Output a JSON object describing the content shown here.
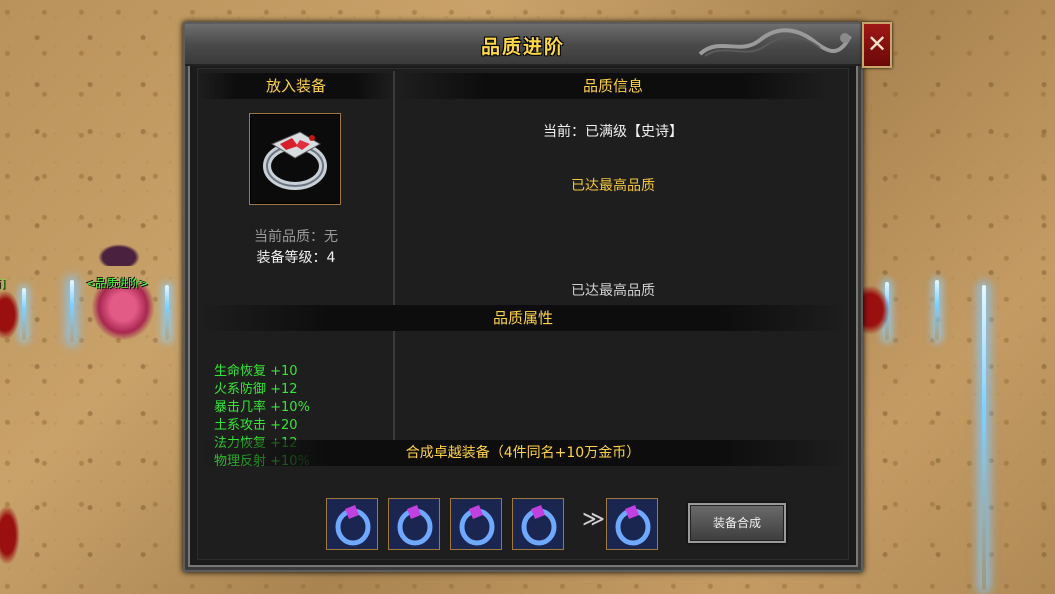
{
  "world": {
    "npc_name": "<品质进阶>",
    "npc_name_left": "商]"
  },
  "dialog": {
    "title": "品质进阶",
    "close_label": "✕"
  },
  "left_panel": {
    "header": "放入装备",
    "current_quality": "当前品质：无",
    "equip_level": "装备等级：4"
  },
  "right_panel": {
    "header": "品质信息",
    "current": "当前：已满级【史诗】",
    "max_quality_1": "已达最高品质",
    "max_quality_2": "已达最高品质"
  },
  "attributes": {
    "header": "品质属性",
    "items": [
      "生命恢复 +10",
      "火系防御 +12",
      "暴击几率 +10%",
      "土系攻击 +20",
      "法力恢复 +12",
      "物理反射 +10%"
    ]
  },
  "synthesis": {
    "header": "合成卓越装备（4件同名+10万金币）",
    "arrow": "≫",
    "button_label": "装备合成"
  },
  "colors": {
    "title_gold": "#ffd84a",
    "header_gold": "#ffd24a",
    "attr_green": "#35e635",
    "gold_text": "#f2c73a"
  }
}
